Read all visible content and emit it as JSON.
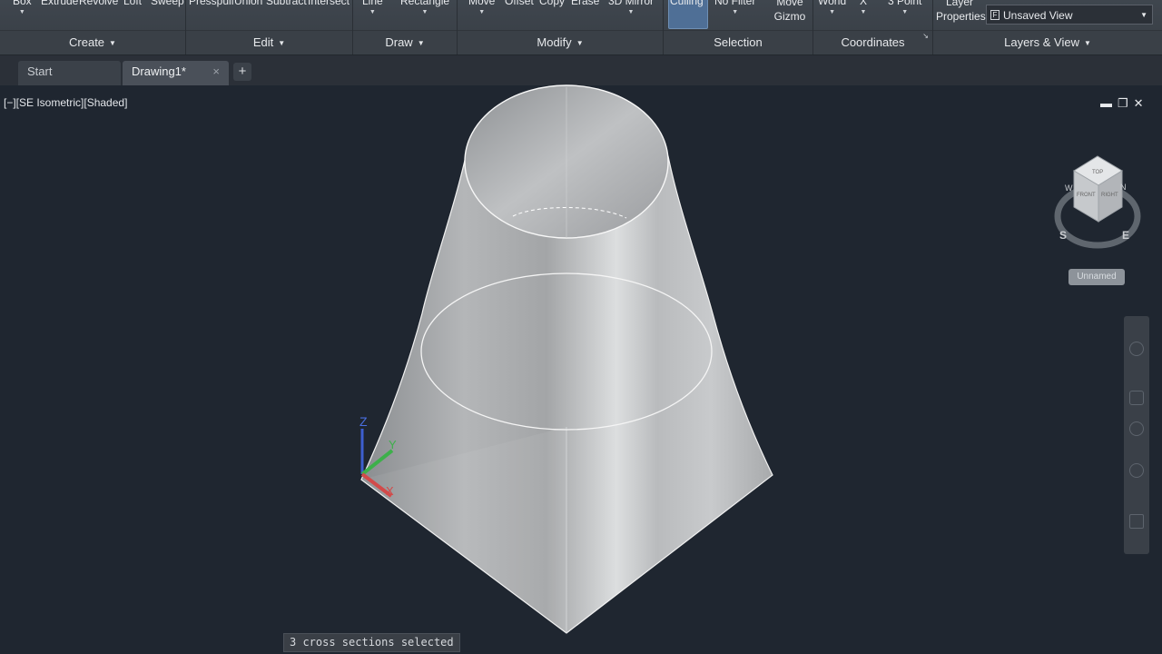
{
  "ribbon": {
    "panels": [
      {
        "title": "Create",
        "tools": [
          "Box",
          "Extrude",
          "Revolve",
          "Loft",
          "Sweep"
        ]
      },
      {
        "title": "Edit",
        "tools": [
          "Presspull",
          "Union",
          "Subtract",
          "Intersect"
        ]
      },
      {
        "title": "Draw",
        "tools": [
          "Line",
          "Rectangle"
        ]
      },
      {
        "title": "Modify",
        "tools": [
          "Move",
          "Offset",
          "Copy",
          "Erase",
          "3D Mirror"
        ]
      },
      {
        "title": "Selection",
        "tools": [
          "Culling",
          "No Filter",
          "Move Gizmo"
        ]
      },
      {
        "title": "Coordinates",
        "tools": [
          "World",
          "X",
          "3 Point"
        ]
      },
      {
        "title": "Layers & View",
        "tools": [
          "Layer Properties"
        ]
      }
    ],
    "view_select": "Unsaved View"
  },
  "tabs": [
    {
      "label": "Start"
    },
    {
      "label": "Drawing1*"
    }
  ],
  "viewport": {
    "label": "[−][SE Isometric][Shaded]",
    "viewcube": {
      "top": "TOP",
      "front": "FRONT",
      "right": "RIGHT",
      "compass": [
        "S",
        "E",
        "N",
        "W"
      ]
    },
    "ucs_menu": "Unnamed",
    "axes": {
      "x": "X",
      "y": "Y",
      "z": "Z"
    }
  },
  "status": "3 cross sections selected",
  "colors": {
    "background": "#1f2630",
    "ribbon": "#3c434b",
    "highlight": "#4f6f96"
  }
}
